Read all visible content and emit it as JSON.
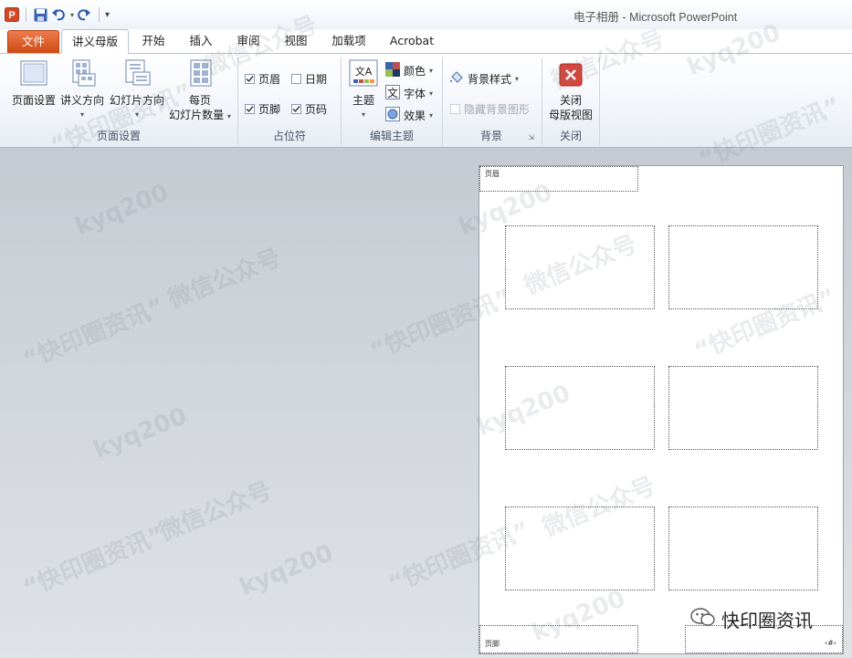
{
  "window": {
    "title": "电子相册 - Microsoft PowerPoint"
  },
  "qat": {
    "app_icon": "P"
  },
  "tabs": [
    {
      "label": "文件"
    },
    {
      "label": "讲义母版"
    },
    {
      "label": "开始"
    },
    {
      "label": "插入"
    },
    {
      "label": "审阅"
    },
    {
      "label": "视图"
    },
    {
      "label": "加载项"
    },
    {
      "label": "Acrobat"
    }
  ],
  "ribbon": {
    "page_setup": {
      "label": "页面设置",
      "page_setup_btn": "页面设置",
      "handout_orientation": "讲义方向",
      "slide_orientation": "幻灯片方向",
      "slides_per_page_line1": "每页",
      "slides_per_page_line2": "幻灯片数量"
    },
    "placeholders": {
      "label": "占位符",
      "header": "页眉",
      "date": "日期",
      "footer": "页脚",
      "page_number": "页码"
    },
    "edit_theme": {
      "label": "编辑主题",
      "themes": "主题",
      "themes_glyph": "文A",
      "colors": "颜色",
      "fonts": "字体",
      "fonts_glyph": "文",
      "effects": "效果"
    },
    "background": {
      "label": "背景",
      "styles": "背景样式",
      "hide_graphics": "隐藏背景图形"
    },
    "close": {
      "label": "关闭",
      "close_line1": "关闭",
      "close_line2": "母版视图"
    }
  },
  "handout": {
    "header": "页眉",
    "footer": "页脚",
    "page_num": "‹#›"
  },
  "watermarks": {
    "w1": "kyq200",
    "w2": "“快印圈资讯”",
    "w3": "微信公众号"
  },
  "brand": {
    "text": "快印圈资讯"
  }
}
